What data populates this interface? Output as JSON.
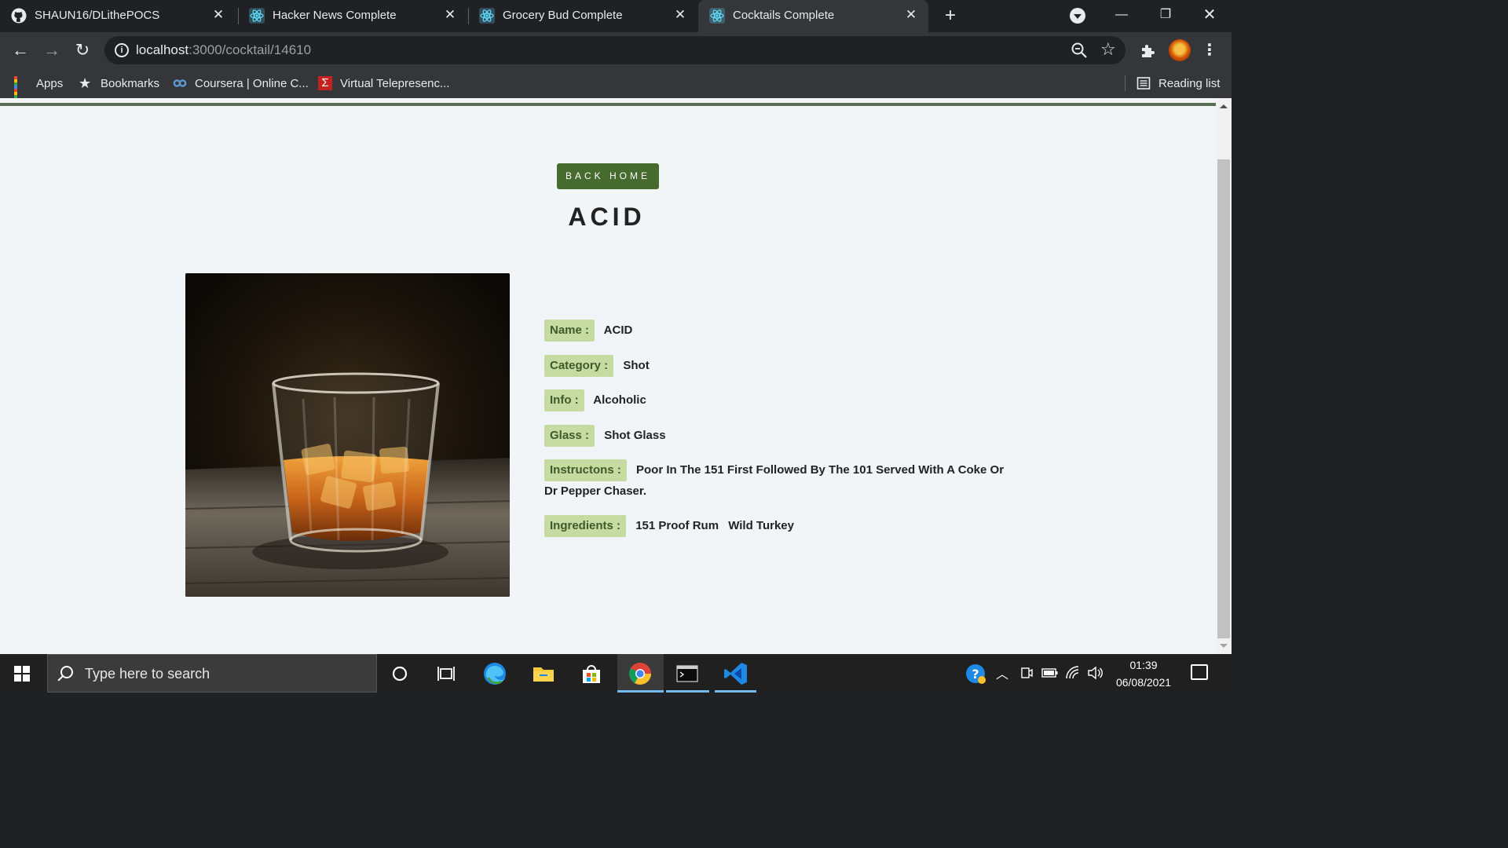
{
  "browser": {
    "tabs": [
      {
        "title": "SHAUN16/DLithePOCS",
        "favicon": "github-icon",
        "active": false
      },
      {
        "title": "Hacker News Complete",
        "favicon": "react-icon",
        "active": false
      },
      {
        "title": "Grocery Bud Complete",
        "favicon": "react-icon",
        "active": false
      },
      {
        "title": "Cocktails Complete",
        "favicon": "react-icon",
        "active": true
      }
    ],
    "url_host": "localhost",
    "url_rest": ":3000/cocktail/14610",
    "bookmarks": [
      {
        "label": "Apps",
        "icon": "apps-grid-icon"
      },
      {
        "label": "Bookmarks",
        "icon": "star-icon"
      },
      {
        "label": "Coursera | Online C...",
        "icon": "coursera-icon"
      },
      {
        "label": "Virtual Telepresenc...",
        "icon": "sigma-icon"
      }
    ],
    "reading_list": "Reading list"
  },
  "page": {
    "back_button": "BACK HOME",
    "title": "ACID",
    "image_alt": "glass of whisky with ice",
    "info": {
      "name_label": "Name :",
      "name": "ACID",
      "category_label": "Category :",
      "category": "Shot",
      "info_label": "Info :",
      "info": "Alcoholic",
      "glass_label": "Glass :",
      "glass": "Shot Glass",
      "instructions_label": "Instructons :",
      "instructions": "Poor In The 151 First Followed By The 101 Served With A Coke Or Dr Pepper Chaser.",
      "ingredients_label": "Ingredients :",
      "ingredients": [
        "151 Proof Rum",
        "Wild Turkey"
      ]
    },
    "accent_color": "#476a2e",
    "label_bg": "#c6dba1"
  },
  "taskbar": {
    "search_placeholder": "Type here to search",
    "time": "01:39",
    "date": "06/08/2021"
  }
}
